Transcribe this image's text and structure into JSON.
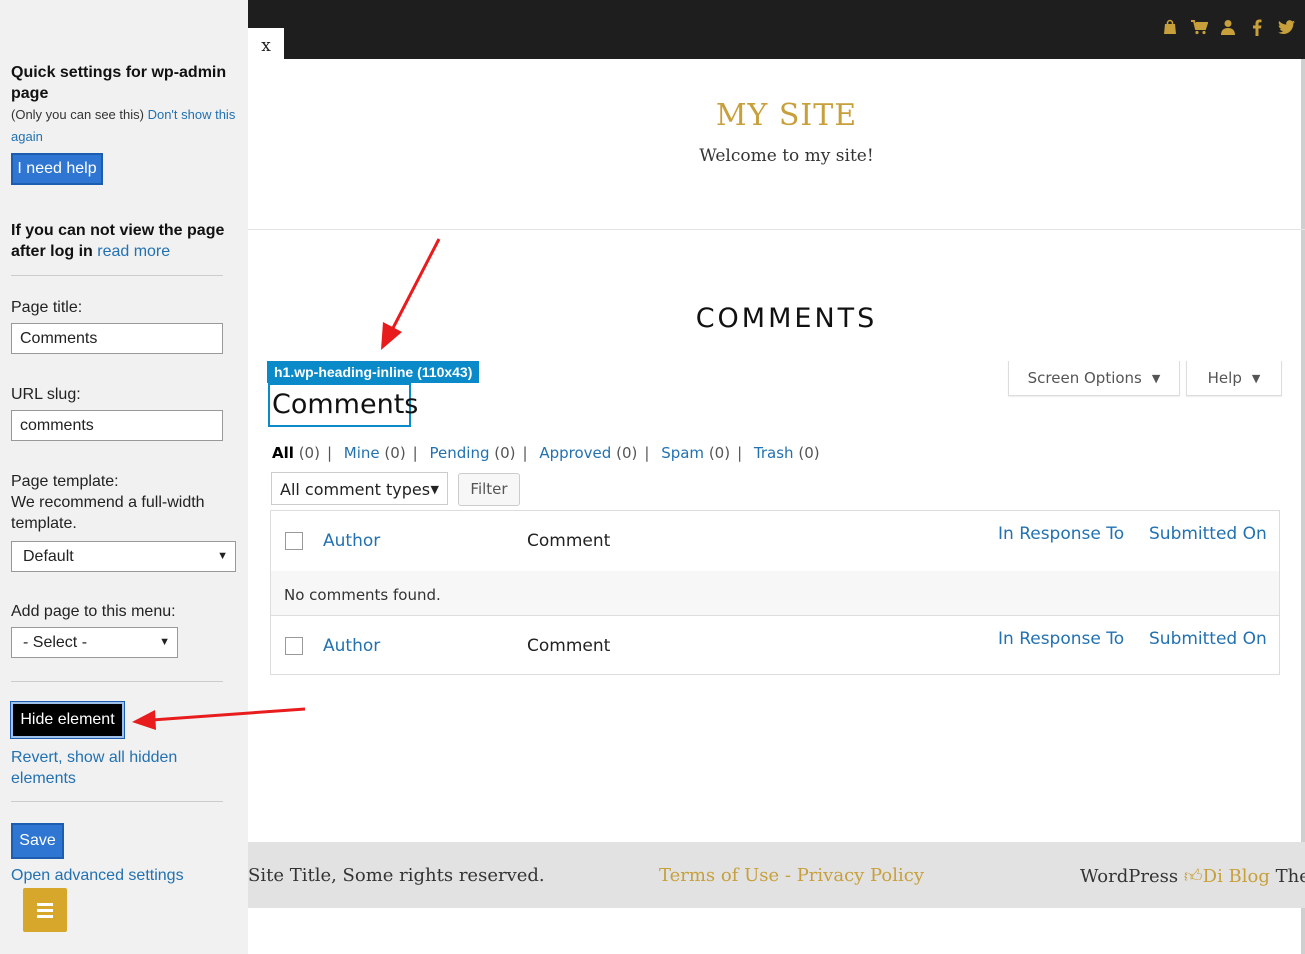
{
  "topbar": {
    "icons": [
      "shopping-bag-icon",
      "cart-icon",
      "user-icon",
      "facebook-icon",
      "twitter-icon"
    ],
    "color": "#c7a03c"
  },
  "site": {
    "title": "MY SITE",
    "tagline": "Welcome to my site!",
    "page_heading": "COMMENTS"
  },
  "admin": {
    "element_tag": "h1.wp-heading-inline (110x43)",
    "heading": "Comments",
    "screen_options": "Screen Options",
    "help": "Help",
    "filters": [
      {
        "label": "All",
        "count": "(0)"
      },
      {
        "label": "Mine",
        "count": "(0)"
      },
      {
        "label": "Pending",
        "count": "(0)"
      },
      {
        "label": "Approved",
        "count": "(0)"
      },
      {
        "label": "Spam",
        "count": "(0)"
      },
      {
        "label": "Trash",
        "count": "(0)"
      }
    ],
    "comment_type_select": "All comment types",
    "filter_button": "Filter",
    "table": {
      "columns": [
        "Author",
        "Comment",
        "In Response To",
        "Submitted On"
      ],
      "empty_message": "No comments found."
    }
  },
  "footer": {
    "copyright": "Site Title, Some rights reserved.",
    "links": "Terms of Use - Privacy Policy",
    "credit_prefix": "WordPress",
    "credit_theme": "Di Blog",
    "credit_suffix": "Ther"
  },
  "sidebar": {
    "close": "x",
    "title": "Quick settings for wp-admin page",
    "only_you": "(Only you can see this)",
    "dont_show": "Don't show this again",
    "help_button": "I need help",
    "cant_view": "If you can not view the page after log in",
    "read_more": "read more",
    "page_title_label": "Page title:",
    "page_title_value": "Comments",
    "url_slug_label": "URL slug:",
    "url_slug_value": "comments",
    "template_label": "Page template:",
    "template_note": "We recommend a full-width template.",
    "template_value": "Default",
    "menu_label": "Add page to this menu:",
    "menu_value": "- Select -",
    "hide_button": "Hide element",
    "revert_link": "Revert, show all hidden elements",
    "save_button": "Save",
    "advanced_link": "Open advanced settings"
  },
  "colors": {
    "accent_gold": "#c7a03c",
    "wp_link": "#2271b1",
    "highlight_blue": "#0b8ac9",
    "arrow_red": "#e81c1c"
  }
}
